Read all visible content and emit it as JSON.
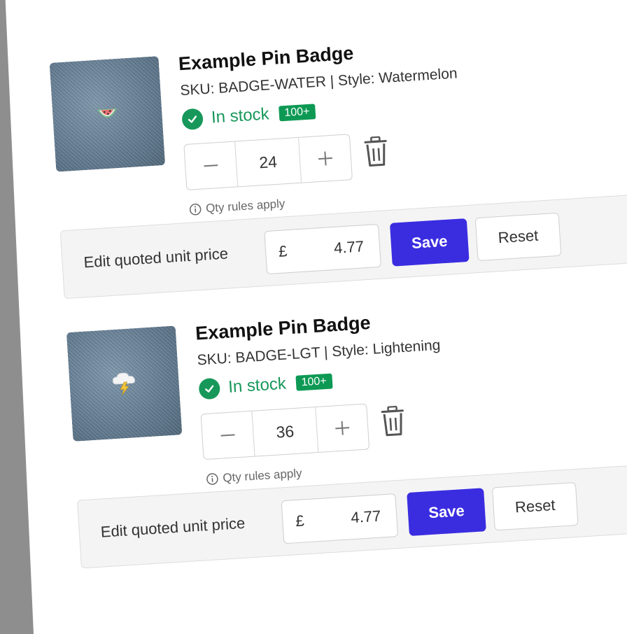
{
  "items": [
    {
      "title": "Example Pin Badge",
      "sku_line": "SKU: BADGE-WATER | Style: Watermelon",
      "stock_text": "In stock",
      "stock_badge": "100+",
      "quantity": "24",
      "qty_rules": "Qty rules apply",
      "price_label": "Edit quoted unit price",
      "currency": "£",
      "price": "4.77",
      "save_label": "Save",
      "reset_label": "Reset",
      "image_icon": "watermelon-pin-icon"
    },
    {
      "title": "Example Pin Badge",
      "sku_line": "SKU: BADGE-LGT | Style: Lightening",
      "stock_text": "In stock",
      "stock_badge": "100+",
      "quantity": "36",
      "qty_rules": "Qty rules apply",
      "price_label": "Edit quoted unit price",
      "currency": "£",
      "price": "4.77",
      "save_label": "Save",
      "reset_label": "Reset",
      "image_icon": "lightning-cloud-pin-icon"
    }
  ],
  "colors": {
    "in_stock": "#17985a",
    "badge": "#0d9954",
    "save_button": "#3a2de0",
    "panel": "#f4f4f4"
  }
}
